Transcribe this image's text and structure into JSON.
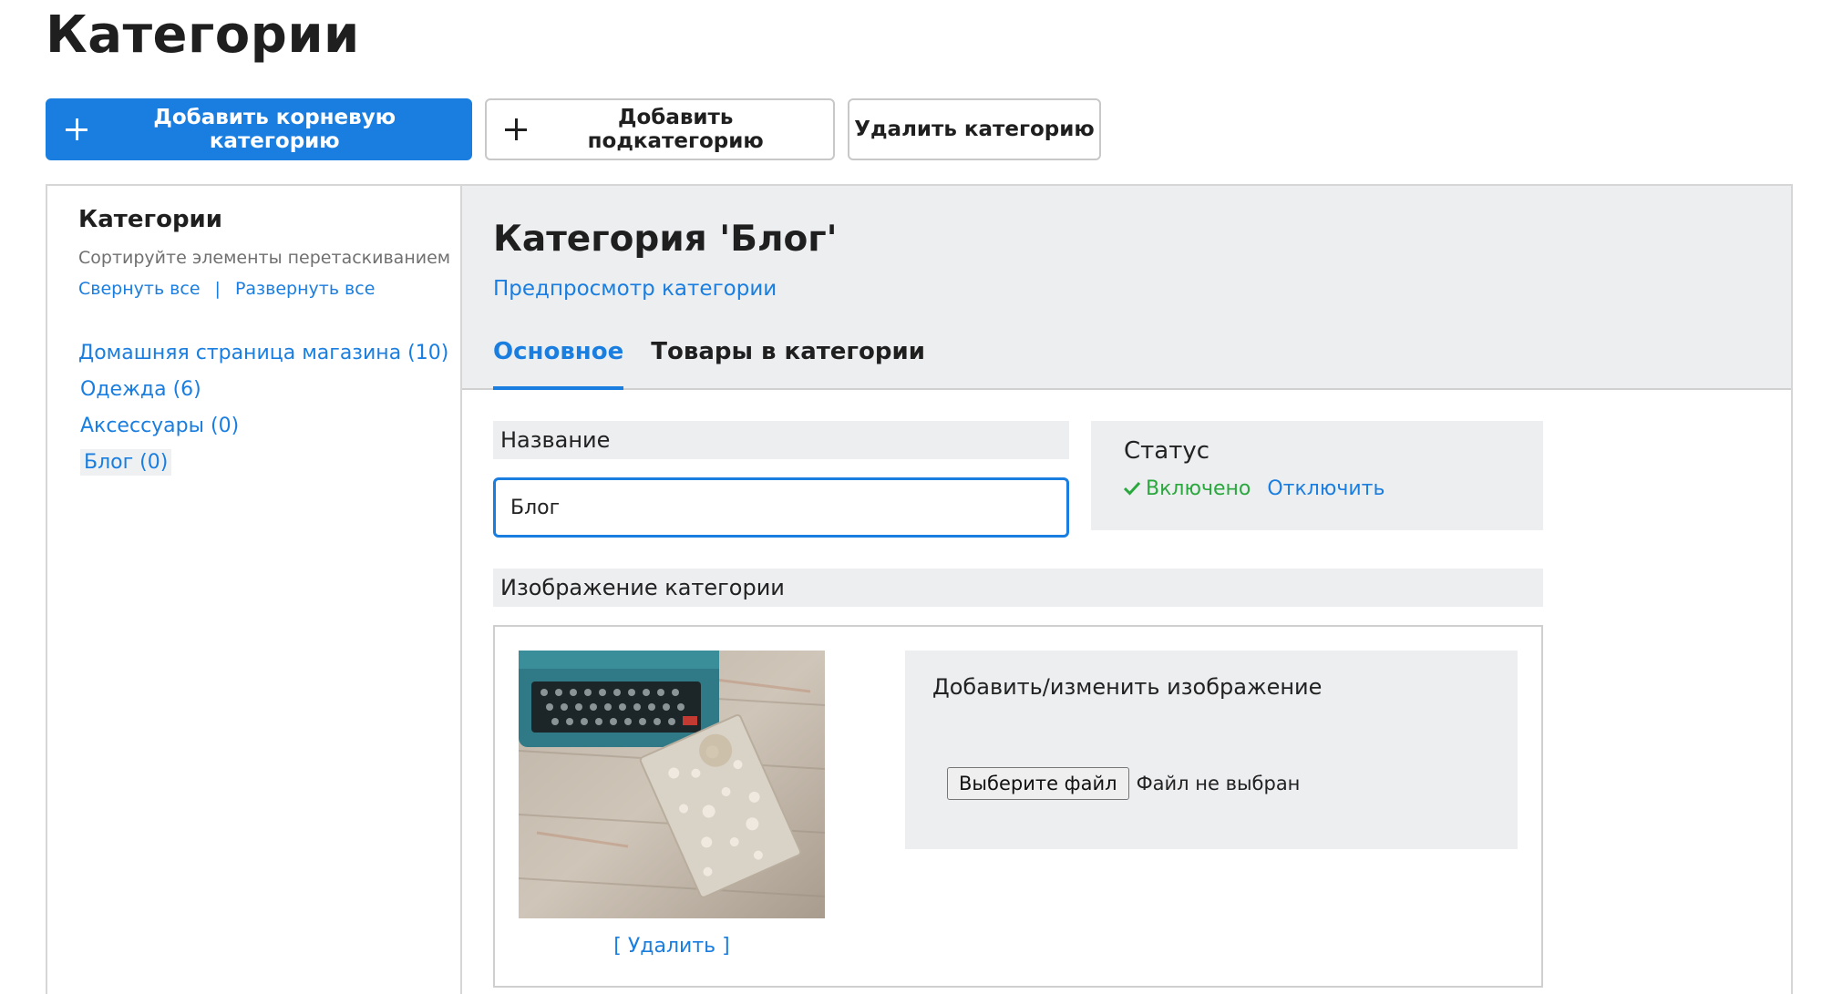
{
  "page": {
    "title": "Категории"
  },
  "toolbar": {
    "add_root": "Добавить корневую категорию",
    "add_sub": "Добавить подкатегорию",
    "delete": "Удалить категорию"
  },
  "sidebar": {
    "title": "Категории",
    "hint": "Сортируйте элементы перетаскиванием",
    "collapse_all": "Свернуть все",
    "separator": "|",
    "expand_all": "Развернуть все",
    "items": [
      {
        "label": "Домашняя страница магазина (10)"
      },
      {
        "label": "Одежда (6)"
      },
      {
        "label": "Аксессуары (0)"
      },
      {
        "label": "Блог (0)"
      }
    ]
  },
  "main": {
    "heading": "Категория 'Блог'",
    "preview_link": "Предпросмотр категории",
    "tabs": [
      {
        "label": "Основное",
        "active": true
      },
      {
        "label": "Товары в категории",
        "active": false
      }
    ],
    "name_label": "Название",
    "name_value": "Блог",
    "status": {
      "title": "Статус",
      "on_icon": "checkmark-icon",
      "on_label": "Включено",
      "off_label": "Отключить"
    },
    "image": {
      "label": "Изображение категории",
      "delete_link": "[ Удалить ]",
      "upload_title": "Добавить/изменить изображение",
      "file_button": "Выберите файл",
      "file_none": "Файл не выбран"
    }
  },
  "colors": {
    "accent": "#1a7ee0",
    "enabled": "#2aa83e",
    "panel_bg": "#eceef0"
  }
}
